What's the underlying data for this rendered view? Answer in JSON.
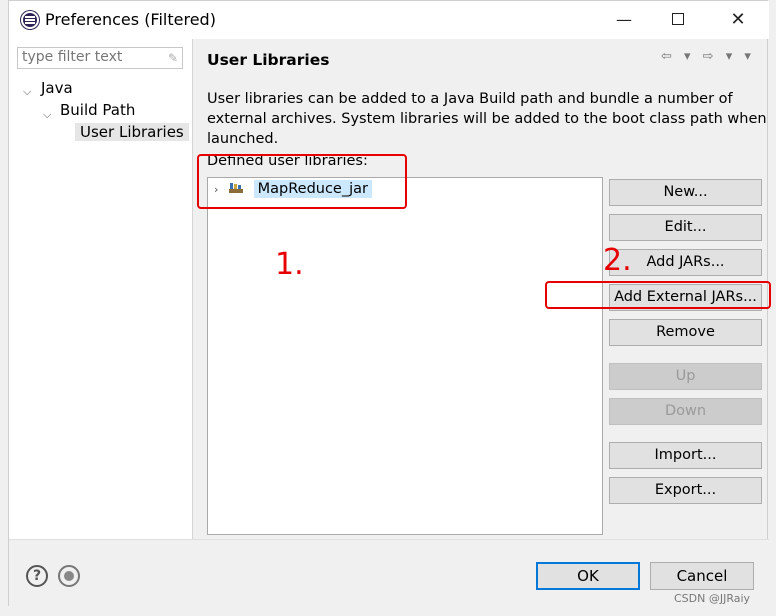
{
  "window": {
    "title": "Preferences (Filtered)",
    "minimize": "—",
    "close": "✕"
  },
  "left": {
    "filter_placeholder": "type filter text",
    "tree": [
      "Java",
      "Build Path",
      "User Libraries"
    ]
  },
  "main": {
    "title": "User Libraries",
    "description": "User libraries can be added to a Java Build path and bundle a number of external archives. System libraries will be added to the boot class path when launched.",
    "section_label": "Defined user libraries:",
    "libraries": [
      "MapReduce_jar"
    ],
    "buttons": {
      "new": "New...",
      "edit": "Edit...",
      "add_jars": "Add JARs...",
      "add_external_jars": "Add External JARs...",
      "remove": "Remove",
      "up": "Up",
      "down": "Down",
      "import": "Import...",
      "export": "Export..."
    }
  },
  "annotations": {
    "step1": "1.",
    "step2": "2."
  },
  "footer": {
    "ok": "OK",
    "cancel": "Cancel"
  },
  "watermark": "CSDN @JJRaiy",
  "colors": {
    "annotation": "#e60000",
    "selection": "#cce8ff",
    "primary_border": "#0078d7"
  }
}
